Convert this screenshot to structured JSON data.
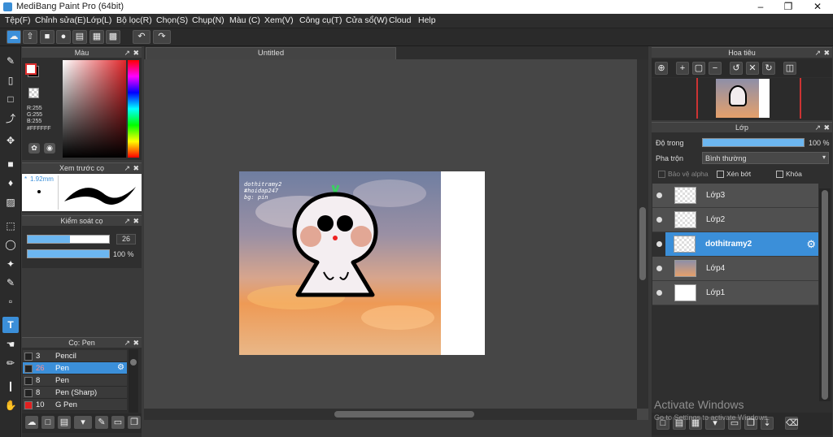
{
  "window": {
    "title": "MediBang Paint Pro (64bit)"
  },
  "menu": [
    "Tệp(F)",
    "Chỉnh sửa(E)",
    "Lớp(L)",
    "Bộ lọc(R)",
    "Chọn(S)",
    "Chụp(N)",
    "Màu (C)",
    "Xem(V)",
    "Công cụ(T)",
    "Cửa sổ(W)",
    "Cloud",
    "Help"
  ],
  "color_panel": {
    "title": "Màu",
    "r": "R:255",
    "g": "G:255",
    "b": "B:255",
    "hex": "#FFFFFF"
  },
  "brush_preview": {
    "title": "Xem trước cọ",
    "size": "1.92mm"
  },
  "brush_control": {
    "title": "Kiểm soát cọ",
    "size_value": "26",
    "size_fill": 0.52,
    "opacity_value": "100 %",
    "opacity_fill": 1.0
  },
  "brush_list": {
    "title": "Cọ: Pen",
    "items": [
      {
        "size": "3",
        "name": "Pencil",
        "color": "#222222",
        "selected": false
      },
      {
        "size": "26",
        "name": "Pen",
        "color": "#222222",
        "selected": true
      },
      {
        "size": "8",
        "name": "Pen",
        "color": "#222222",
        "selected": false
      },
      {
        "size": "8",
        "name": "Pen (Sharp)",
        "color": "#222222",
        "selected": false
      },
      {
        "size": "10",
        "name": "G Pen",
        "color": "#e02020",
        "selected": false
      }
    ]
  },
  "document": {
    "tab_title": "Untitled",
    "caption_lines": [
      "dothitramy2",
      "#hoidap247",
      "bg: pin"
    ]
  },
  "navigator": {
    "title": "Hoa tiêu"
  },
  "layers_panel": {
    "title": "Lớp",
    "opacity_label": "Độ trong",
    "opacity_value": "100 %",
    "blend_label": "Pha trộn",
    "blend_value": "Bình thường",
    "protect_alpha": "Bảo vệ alpha",
    "clipping": "Xén bớt",
    "lock": "Khóa",
    "layers": [
      {
        "name": "Lớp3",
        "selected": false
      },
      {
        "name": "Lớp2",
        "selected": false
      },
      {
        "name": "dothitramy2",
        "selected": true
      },
      {
        "name": "Lớp4",
        "selected": false
      },
      {
        "name": "Lớp1",
        "selected": false
      }
    ]
  },
  "watermark": {
    "line1": "Activate Windows",
    "line2": "Go to Settings to activate Windows."
  },
  "colors": {
    "accent": "#3b8fd9",
    "panel_bg": "#2f2f2f",
    "canvas_bg": "#464646"
  }
}
